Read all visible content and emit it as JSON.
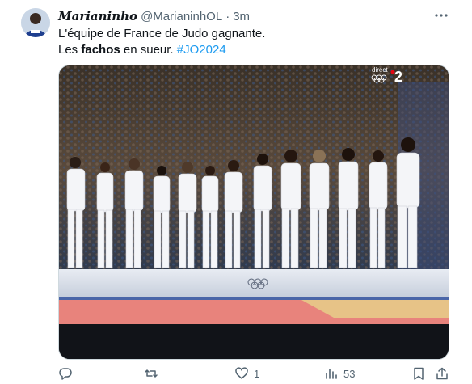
{
  "tweet": {
    "display_name": "Marianinho",
    "handle": "@MarianinhOL",
    "separator": "·",
    "time": "3m",
    "text_line1": "L'équipe de France de Judo gagnante.",
    "text_line2_prefix": "Les ",
    "text_line2_bold": "fachos",
    "text_line2_suffix": " en sueur. ",
    "hashtag": "#JO2024",
    "more_icon": "more-horizontal-icon"
  },
  "media": {
    "broadcast_label": "direct",
    "channel_number": "2"
  },
  "actions": {
    "reply_count": "",
    "retweet_count": "",
    "like_count": "1",
    "views_count": "53"
  },
  "colors": {
    "text": "#0f1419",
    "muted": "#536471",
    "accent": "#1d9bf0",
    "border": "#cfd9de"
  }
}
